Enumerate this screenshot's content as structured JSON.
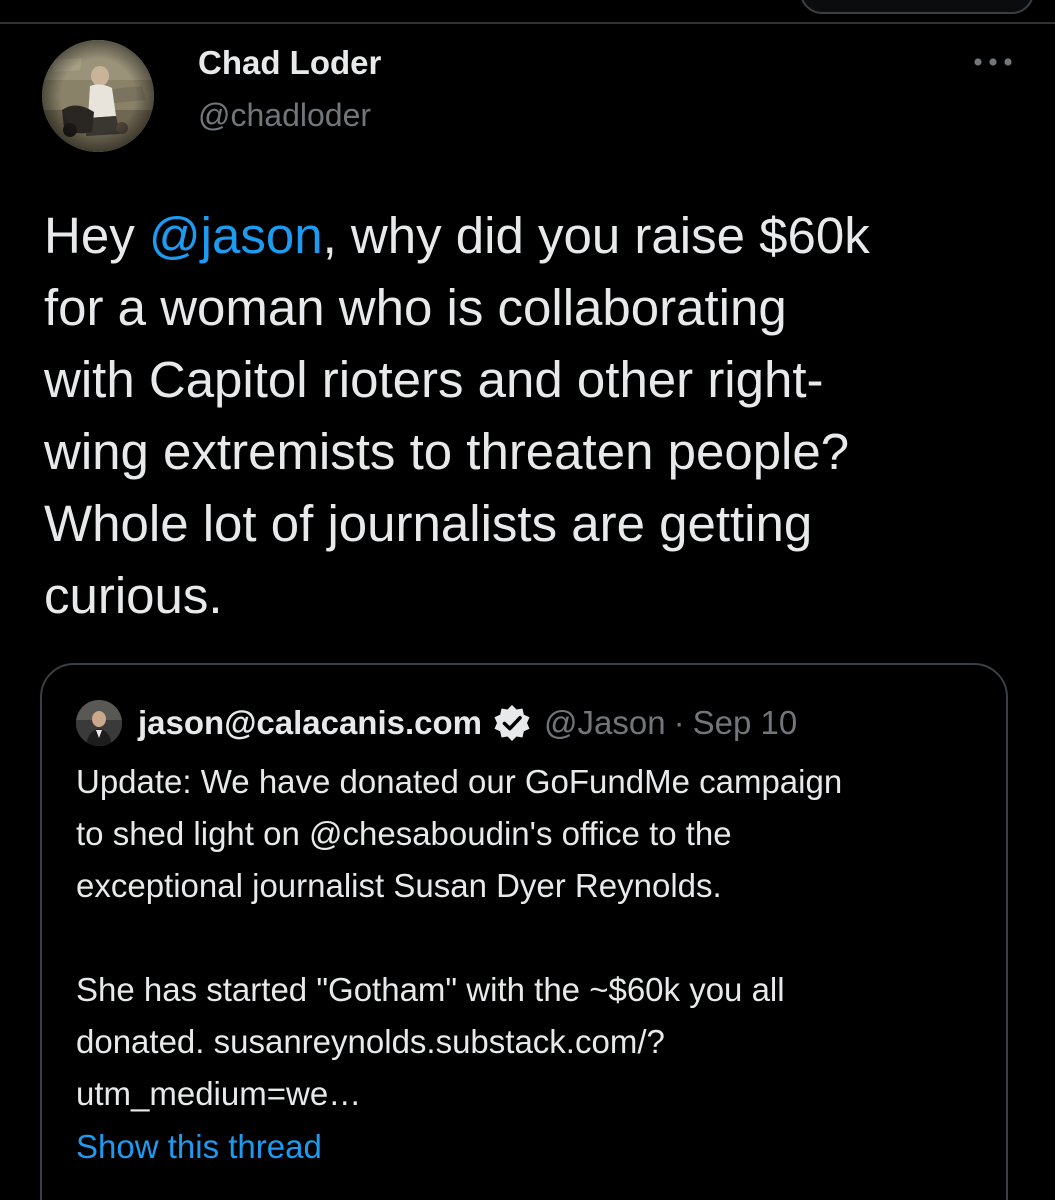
{
  "tweet": {
    "author": {
      "name": "Chad Loder",
      "handle": "@chadloder",
      "avatar_icon": "profile-photo"
    },
    "more_icon": "more-horizontal-icon",
    "text": {
      "before_mention": "Hey ",
      "mention": "@jason",
      "after_mention": ", why did you raise $60k\nfor a woman who is collaborating\nwith Capitol rioters and other right-\nwing extremists to threaten people?\nWhole lot of journalists are getting\ncurious."
    },
    "quoted": {
      "name": "jason@calacanis.com",
      "verified_icon": "verified-badge-icon",
      "handle": "@Jason",
      "separator": "·",
      "date": "Sep 10",
      "paragraph1": "Update: We have donated our GoFundMe campaign\nto shed light on @chesaboudin's office to the\nexceptional journalist Susan Dyer Reynolds.",
      "paragraph2": "She has started \"Gotham\" with the ~$60k you all\ndonated.  susanreynolds.substack.com/?\nutm_medium=we…",
      "show_thread": "Show this thread"
    }
  },
  "colors": {
    "background": "#000000",
    "text_primary": "#e7e9ea",
    "text_secondary": "#71767b",
    "accent": "#1d9bf0",
    "border": "#3a3f43"
  }
}
